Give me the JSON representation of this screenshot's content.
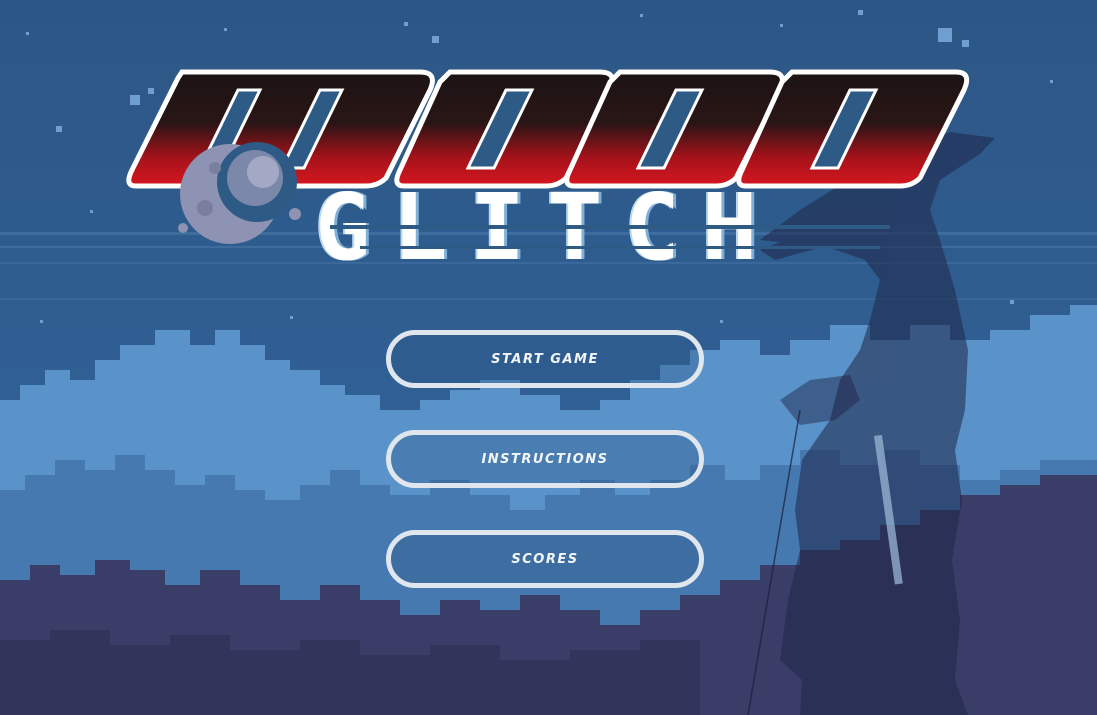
{
  "logo": {
    "title": "MOON",
    "subtitle": "GLITCH"
  },
  "menu": {
    "start_label": "START GAME",
    "instructions_label": "INSTRUCTIONS",
    "scores_label": "SCORES"
  },
  "colors": {
    "sky": "#2e5a86",
    "cloud_light": "#5a93c9",
    "cloud_mid": "#4a7fb6",
    "ground_dark": "#3a3b66",
    "logo_red": "#c4141c",
    "logo_black": "#1c1414",
    "button_border": "#dfe6ee"
  },
  "icons": {
    "moon": "crescent-moon-icon",
    "samurai": "samurai-silhouette"
  }
}
